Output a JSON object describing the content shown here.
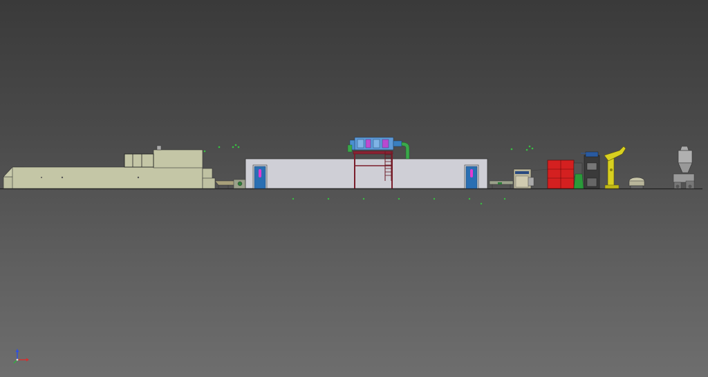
{
  "viewport": {
    "background_top": "#3a3a3a",
    "background_bottom": "#6e6e6e"
  },
  "colors": {
    "ground_line": "#222222",
    "oven_body": "#c4c6a6",
    "cleanroom_wall": "#cfcfd6",
    "door_blue": "#2a6fb3",
    "door_window": "#e23ad0",
    "steel_frame": "#7a1d2a",
    "duct_blue": "#4a8fd0",
    "duct_green": "#3aa84a",
    "mixer_red": "#d42020",
    "lift_yellow": "#d8d020",
    "marker_green": "#37c241",
    "axis_x": "#d43030",
    "axis_y": "#30b040",
    "axis_z": "#3050e0"
  },
  "equipment": [
    {
      "name": "tunnel-oven",
      "kind": "oven"
    },
    {
      "name": "transfer-conveyor-left",
      "kind": "conveyor"
    },
    {
      "name": "clean-room",
      "kind": "enclosure"
    },
    {
      "name": "air-handling-unit",
      "kind": "hvac"
    },
    {
      "name": "transfer-conveyor-right",
      "kind": "conveyor"
    },
    {
      "name": "divider-rounder",
      "kind": "machine"
    },
    {
      "name": "spiral-mixer",
      "kind": "mixer"
    },
    {
      "name": "bowl-lift",
      "kind": "lift"
    },
    {
      "name": "mixing-bowl",
      "kind": "bowl"
    },
    {
      "name": "silo-feeder",
      "kind": "feeder"
    }
  ],
  "icons": {
    "axis_triad": "xyz-axis-icon"
  }
}
